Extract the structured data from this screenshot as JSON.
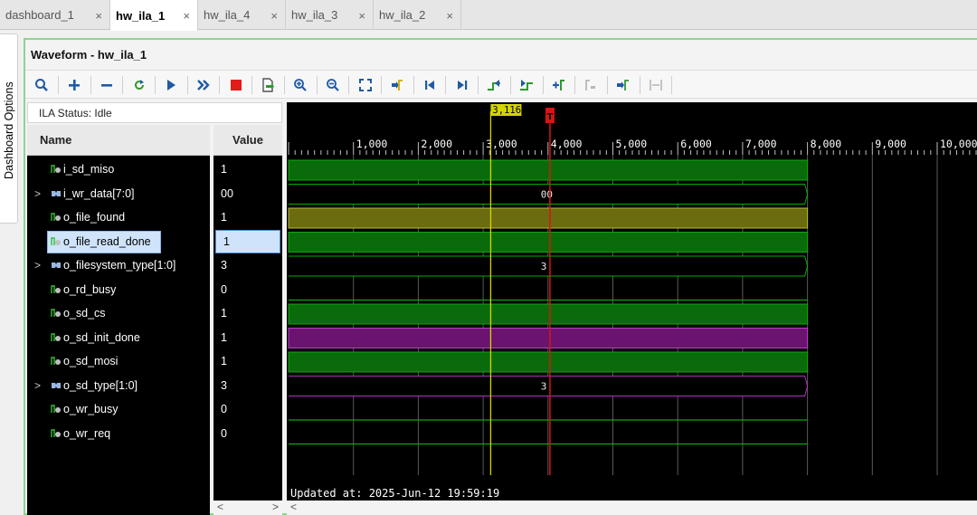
{
  "tabs": [
    {
      "label": "dashboard_1",
      "close": "×"
    },
    {
      "label": "hw_ila_1",
      "close": "×"
    },
    {
      "label": "hw_ila_4",
      "close": "×"
    },
    {
      "label": "hw_ila_3",
      "close": "×"
    },
    {
      "label": "hw_ila_2",
      "close": "×"
    }
  ],
  "dashboard_options_label": "Dashboard Options",
  "waveform_title": "Waveform - hw_ila_1",
  "ila_status": "ILA Status:  Idle",
  "columns": {
    "name": "Name",
    "value": "Value"
  },
  "signals": [
    {
      "name": "i_sd_miso",
      "value": "1",
      "kind": "bit",
      "wave_value": "",
      "expandable": false
    },
    {
      "name": "i_wr_data[7:0]",
      "value": "00",
      "kind": "bus",
      "wave_value": "00",
      "expandable": true
    },
    {
      "name": "o_file_found",
      "value": "1",
      "kind": "bit",
      "wave_value": "",
      "expandable": false
    },
    {
      "name": "o_file_read_done",
      "value": "1",
      "kind": "bit",
      "wave_value": "",
      "expandable": false
    },
    {
      "name": "o_filesystem_type[1:0]",
      "value": "3",
      "kind": "bus",
      "wave_value": "3",
      "expandable": true
    },
    {
      "name": "o_rd_busy",
      "value": "0",
      "kind": "bit",
      "wave_value": "",
      "expandable": false
    },
    {
      "name": "o_sd_cs",
      "value": "1",
      "kind": "bit",
      "wave_value": "",
      "expandable": false
    },
    {
      "name": "o_sd_init_done",
      "value": "1",
      "kind": "bit",
      "wave_value": "",
      "expandable": false
    },
    {
      "name": "o_sd_mosi",
      "value": "1",
      "kind": "bit",
      "wave_value": "",
      "expandable": false
    },
    {
      "name": "o_sd_type[1:0]",
      "value": "3",
      "kind": "bus",
      "wave_value": "3",
      "expandable": true
    },
    {
      "name": "o_wr_busy",
      "value": "0",
      "kind": "bit",
      "wave_value": "",
      "expandable": false
    },
    {
      "name": "o_wr_req",
      "value": "0",
      "kind": "bit",
      "wave_value": "",
      "expandable": false
    }
  ],
  "selected_signal": "o_file_read_done",
  "timeline": {
    "ticks": [
      "1,000",
      "2,000",
      "3,000",
      "4,000",
      "5,000",
      "6,000",
      "7,000",
      "8,000",
      "9,000",
      "10,000"
    ],
    "cursor_label": "3,116",
    "trigger_label": "T",
    "data_end": 8000
  },
  "updated_text": "Updated at: 2025-Jun-12 19:59:19",
  "toolbar_icons": [
    "search-icon",
    "add-icon",
    "remove-icon",
    "refresh-icon",
    "run-icon",
    "run-all-icon",
    "stop-icon",
    "export-icon",
    "zoom-in-icon",
    "zoom-out-icon",
    "zoom-fit-icon",
    "marker-icon",
    "go-first-icon",
    "go-last-icon",
    "prev-transition-icon",
    "next-transition-icon",
    "add-marker-icon",
    "prev-marker-icon",
    "next-marker-icon",
    "swap-cursor-icon"
  ],
  "scroll_arrows": {
    "left": "<",
    "right": ">"
  },
  "colors": {
    "bit_green": "#0a6b0a",
    "bit_olive": "#6b6b10",
    "bit_purple": "#6a1470",
    "bus_border_green": "#00b000",
    "bus_border_purple": "#b030c0",
    "cursor_yellow": "#d4d400",
    "trigger_red": "#d81414",
    "frame_green": "#8fd48f"
  }
}
